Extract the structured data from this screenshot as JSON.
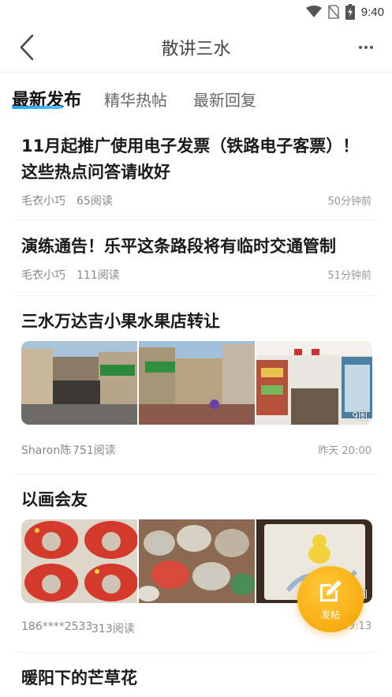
{
  "status_bar": {
    "time": "9:40",
    "icons": [
      "wifi-icon",
      "no-sim-icon",
      "battery-charging-icon"
    ]
  },
  "nav": {
    "title": "散讲三水",
    "back_icon": "chevron-left-icon",
    "more_icon": "more-dots-icon"
  },
  "tabs": [
    {
      "label": "最新发布",
      "active": true
    },
    {
      "label": "精华热帖",
      "active": false
    },
    {
      "label": "最新回复",
      "active": false
    }
  ],
  "accent_color": "#1fa3ff",
  "fab": {
    "label": "发帖",
    "icon": "edit-icon",
    "color": "#f7a800"
  },
  "posts": [
    {
      "title": "11月起推广使用电子发票（铁路电子客票）！这些热点问答请收好",
      "author": "毛衣小巧",
      "reads": "65阅读",
      "time": "50分钟前"
    },
    {
      "title": "演练通告！乐平这条路段将有临时交通管制",
      "author": "毛衣小巧",
      "reads": "111阅读",
      "time": "51分钟前"
    },
    {
      "title": "三水万达吉小果水果店转让",
      "author": "Sharon陈",
      "reads": "751阅读",
      "time": "昨天 20:00",
      "image_count": "9图"
    },
    {
      "title": "以画会友",
      "author": "186****2533",
      "reads": "313阅读",
      "time": "09:13",
      "image_count": "图"
    },
    {
      "title": "暖阳下的芒草花"
    }
  ]
}
